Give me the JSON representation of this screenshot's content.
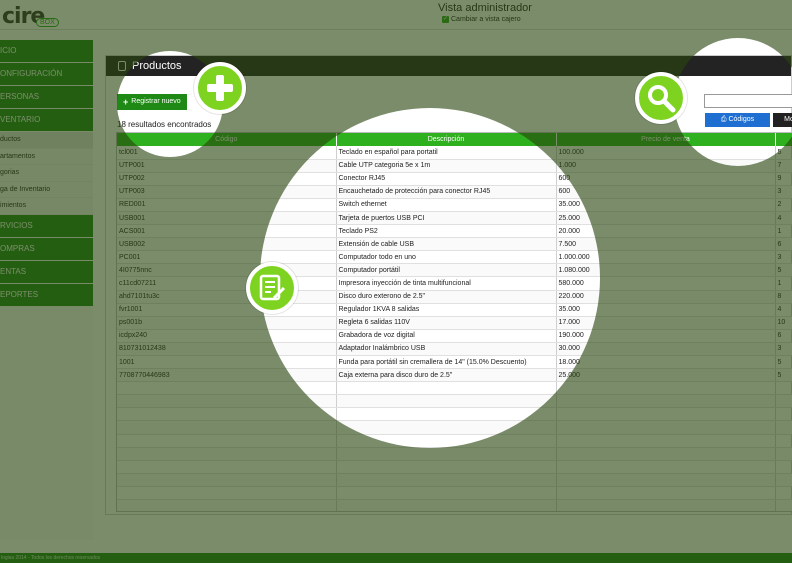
{
  "header": {
    "logo_main": "cire",
    "logo_sub": "BOX",
    "title": "Vista administrador",
    "switch_link": "Cambiar a vista cajero"
  },
  "sidebar": {
    "items": [
      {
        "label": "ICIO",
        "type": "main"
      },
      {
        "label": "ONFIGURACIÓN",
        "type": "main"
      },
      {
        "label": "ERSONAS",
        "type": "main"
      },
      {
        "label": "VENTARIO",
        "type": "main"
      },
      {
        "label": "ductos",
        "type": "sub",
        "active": true
      },
      {
        "label": "artamentos",
        "type": "sub"
      },
      {
        "label": "gorias",
        "type": "sub"
      },
      {
        "label": "ga de Inventario",
        "type": "sub"
      },
      {
        "label": "imientos",
        "type": "sub"
      },
      {
        "label": "RVICIOS",
        "type": "main"
      },
      {
        "label": "OMPRAS",
        "type": "main"
      },
      {
        "label": "ENTAS",
        "type": "main"
      },
      {
        "label": "EPORTES",
        "type": "main"
      }
    ]
  },
  "panel": {
    "title": "Productos",
    "new_button": "Registrar nuevo",
    "results": "18 resultados encontrados",
    "search_placeholder": "",
    "codes_button": "Códigos",
    "more_button": "Mo"
  },
  "table": {
    "columns": [
      "Código",
      "Descripción",
      "Precio de venta",
      ""
    ],
    "rows": [
      [
        "tcl001",
        "Teclado en español para portatil",
        "100.000",
        "5"
      ],
      [
        "UTP001",
        "Cable UTP categoria 5e x 1m",
        "1.000",
        "7"
      ],
      [
        "UTP002",
        "Conector RJ45",
        "600",
        "9"
      ],
      [
        "UTP003",
        "Encauchetado de protección para conector RJ45",
        "600",
        "3"
      ],
      [
        "RED001",
        "Switch ethernet",
        "35.000",
        "2"
      ],
      [
        "USB001",
        "Tarjeta de puertos USB PCI",
        "25.000",
        "4"
      ],
      [
        "ACS001",
        "Teclado PS2",
        "20.000",
        "1"
      ],
      [
        "USB002",
        "Extensión de cable USB",
        "7.500",
        "6"
      ],
      [
        "PC001",
        "Computador todo en uno",
        "1.000.000",
        "3"
      ],
      [
        "4I0775nnc",
        "Computador portátil",
        "1.080.000",
        "5"
      ],
      [
        "c11cd07211",
        "Impresora inyección de tinta multifuncional",
        "580.000",
        "1"
      ],
      [
        "ahd7101tu3c",
        "Disco duro exterono de 2.5\"",
        "220.000",
        "8"
      ],
      [
        "fvr1001",
        "Regulador 1KVA 8 salidas",
        "35.000",
        "4"
      ],
      [
        "ps001b",
        "Regleta 6 salidas 110V",
        "17.000",
        "10"
      ],
      [
        "icdpx240",
        "Grabadora de voz digital",
        "190.000",
        "6"
      ],
      [
        "810731012438",
        "Adaptador Inalámbrico USB",
        "30.000",
        "3"
      ],
      [
        "1001",
        "Funda para portátil sin cremallera de 14\" (15.0% Descuento)",
        "18.000",
        "5"
      ],
      [
        "7708770446983",
        "Caja externa para disco duro de 2.5\"",
        "25.000",
        "5"
      ]
    ],
    "empty_rows": 10
  },
  "footer": {
    "text": "logias 2014 - Todos los derechos reservados"
  },
  "colors": {
    "primary_green": "#1e8a15",
    "header_green": "#2fb01e",
    "badge_green": "#7ed321",
    "overlay": "rgba(40,70,15,0.62)",
    "codes_blue": "#1e6fd1"
  },
  "icons": {
    "add_badge": "plus-icon",
    "search_badge": "search-icon",
    "list_badge": "edit-list-icon"
  }
}
